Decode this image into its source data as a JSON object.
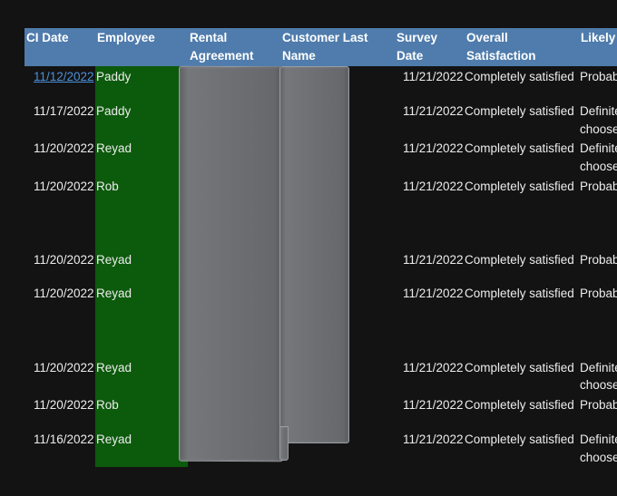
{
  "headers": {
    "ci_date": "CI Date",
    "employee": "Employee",
    "rental_agreement": [
      "Rental",
      "Agreement"
    ],
    "customer_last_name": [
      "Customer Last",
      "Name"
    ],
    "survey_date": [
      "Survey",
      "Date"
    ],
    "overall_satisfaction": [
      "Overall",
      "Satisfaction"
    ],
    "likely": "Likely"
  },
  "rows": [
    {
      "ci_date": "11/12/2022",
      "employee": "Paddy",
      "survey_date": "11/21/2022",
      "satisfaction": "Completely satisfied",
      "likely": [
        "Probab"
      ]
    },
    {
      "ci_date": "11/17/2022",
      "employee": "Paddy",
      "survey_date": "11/21/2022",
      "satisfaction": "Completely satisfied",
      "likely": [
        "Definite",
        "choose"
      ]
    },
    {
      "ci_date": "11/20/2022",
      "employee": "Reyad",
      "survey_date": "11/21/2022",
      "satisfaction": "Completely satisfied",
      "likely": [
        "Definite",
        "choose"
      ]
    },
    {
      "ci_date": "11/20/2022",
      "employee": "Rob",
      "survey_date": "11/21/2022",
      "satisfaction": "Completely satisfied",
      "likely": [
        "Probab"
      ]
    },
    {
      "ci_date": "11/20/2022",
      "employee": "Reyad",
      "survey_date": "11/21/2022",
      "satisfaction": "Completely satisfied",
      "likely": [
        "Probab"
      ]
    },
    {
      "ci_date": "11/20/2022",
      "employee": "Reyad",
      "survey_date": "11/21/2022",
      "satisfaction": "Completely satisfied",
      "likely": [
        "Probab"
      ]
    },
    {
      "ci_date": "11/20/2022",
      "employee": "Reyad",
      "survey_date": "11/21/2022",
      "satisfaction": "Completely satisfied",
      "likely": [
        "Definite",
        "choose"
      ]
    },
    {
      "ci_date": "11/20/2022",
      "employee": "Rob",
      "survey_date": "11/21/2022",
      "satisfaction": "Completely satisfied",
      "likely": [
        "Probab"
      ]
    },
    {
      "ci_date": "11/16/2022",
      "employee": "Reyad",
      "survey_date": "11/21/2022",
      "satisfaction": "Completely satisfied",
      "likely": [
        "Definite",
        "choose"
      ]
    }
  ],
  "colors": {
    "header_bg": "#4f7cac",
    "employee_highlight": "#0c5a0c",
    "link": "#4a90d9",
    "background": "#131313"
  }
}
